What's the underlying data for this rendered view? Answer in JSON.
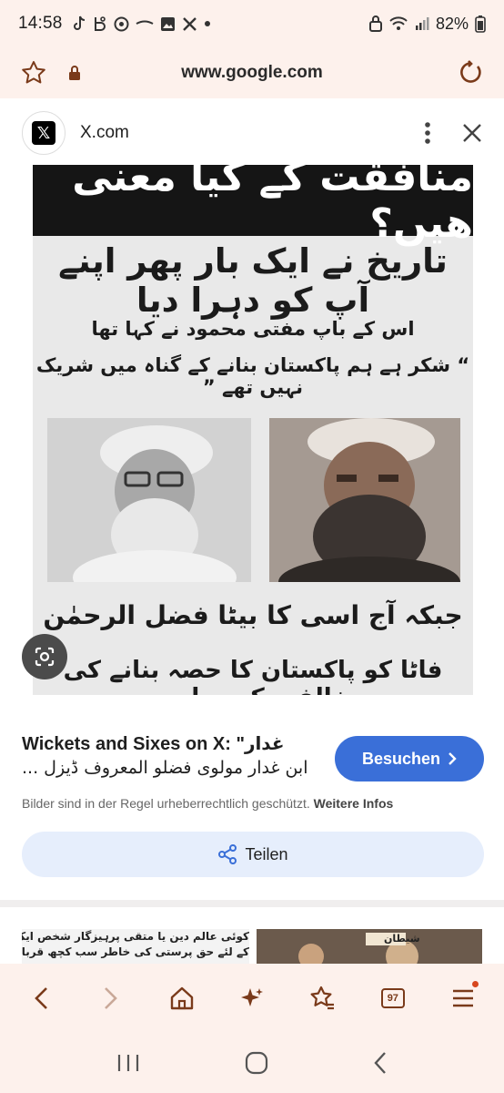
{
  "status_bar": {
    "time": "14:58",
    "battery": "82%",
    "notification_icons": [
      "tiktok-icon",
      "b-icon",
      "chat-icon",
      "dash-icon",
      "image-icon",
      "x-icon",
      "dot-icon"
    ],
    "system_icons": [
      "lock-icon",
      "wifi-icon",
      "signal-icon"
    ]
  },
  "url_bar": {
    "url": "www.google.com"
  },
  "sheet": {
    "site_name": "X.com",
    "image": {
      "headline": "منافقت کے کیا معنی ھیں؟",
      "subhead": "تاریخ نے ایک بار پھر اپنے آپ کو دہرا دیا",
      "line1": "اس کے باپ مفتی محمود نے کہا تھا",
      "line2": "“ شکر ہے ہم پاکستان بنانے کے گناہ میں شریک نہیں تھے ”",
      "caption1": "جبکہ آج اسی کا بیٹا فضل الرحمٰن",
      "caption2": "فاٹا کو پاکستان کا حصہ بنانے کی مخالفت کر رہا ہے۔"
    },
    "result_title_line1": "Wickets and Sixes on X: \"غدار",
    "result_title_line2": "ابن غدار مولوی فضلو المعروف ڈیزل ...",
    "visit_label": "Besuchen",
    "copyright_text": "Bilder sind in der Regel urheberrechtlich geschützt.",
    "more_info_label": "Weitere Infos",
    "share_label": "Teilen",
    "related_left_text": [
      "کوئی عالم دین یا متقی پرہیزگار شخص ایک حکمران",
      "کے لئے حق پرستی کی خاطر سب کچھ قربان کر دیتا"
    ],
    "related_right_text": "شیطان"
  },
  "toolbar": {
    "tab_count": "97"
  },
  "colors": {
    "accent": "#3a6fd8",
    "browser_chrome": "#fdf1ec",
    "icon_brown": "#7a3a1a"
  }
}
